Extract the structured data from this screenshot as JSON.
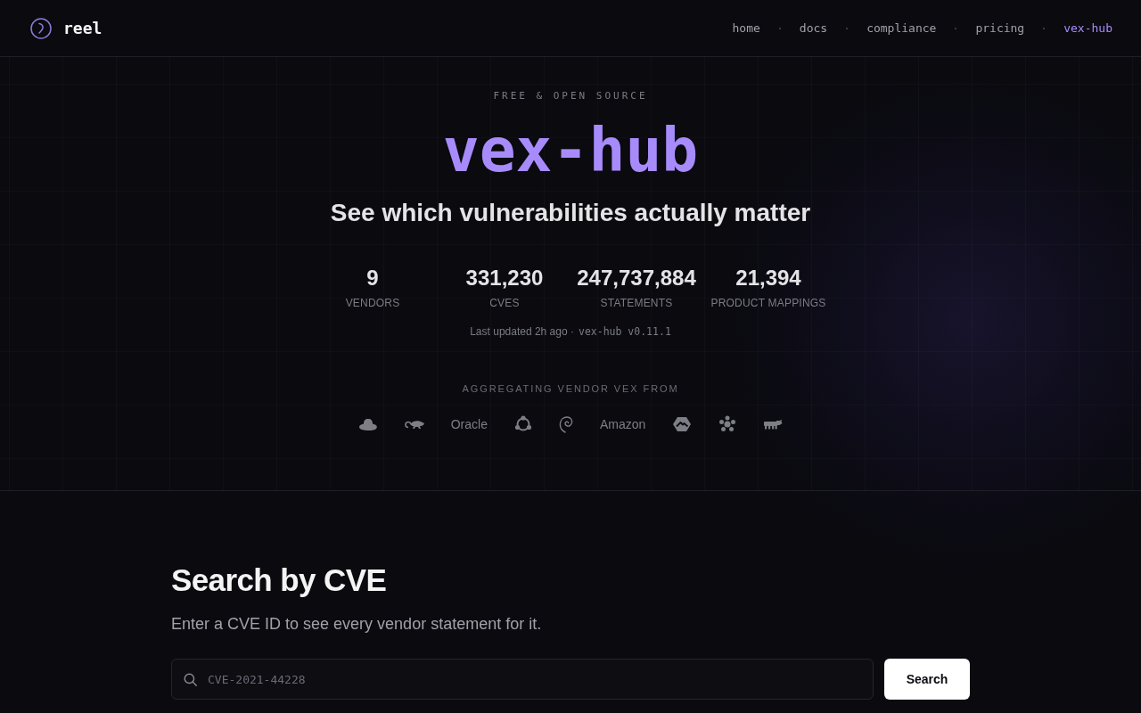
{
  "nav": {
    "brand": "reel",
    "links": [
      {
        "label": "home",
        "selected": false
      },
      {
        "label": "docs",
        "selected": false
      },
      {
        "label": "compliance",
        "selected": false
      },
      {
        "label": "pricing",
        "selected": false
      },
      {
        "label": "vex-hub",
        "selected": true
      }
    ]
  },
  "hero": {
    "eyebrow": "FREE & OPEN SOURCE",
    "title": "vex-hub",
    "subtitle": "See which vulnerabilities actually matter",
    "stats": [
      {
        "value": "9",
        "label": "VENDORS"
      },
      {
        "value": "331,230",
        "label": "CVES"
      },
      {
        "value": "247,737,884",
        "label": "STATEMENTS"
      },
      {
        "value": "21,394",
        "label": "PRODUCT MAPPINGS"
      }
    ],
    "updated": "Last updated 2h ago ·",
    "version": "vex-hub v0.11.1",
    "vendors_heading": "AGGREGATING VENDOR VEX FROM",
    "vendors": [
      {
        "kind": "icon"
      },
      {
        "kind": "icon"
      },
      {
        "kind": "text",
        "label": "Oracle"
      },
      {
        "kind": "icon"
      },
      {
        "kind": "icon"
      },
      {
        "kind": "text",
        "label": "Amazon"
      },
      {
        "kind": "icon"
      },
      {
        "kind": "icon"
      },
      {
        "kind": "icon"
      }
    ]
  },
  "search": {
    "heading": "Search by CVE",
    "description": "Enter a CVE ID to see every vendor statement for it.",
    "placeholder": "CVE-2021-44228",
    "button": "Search"
  }
}
